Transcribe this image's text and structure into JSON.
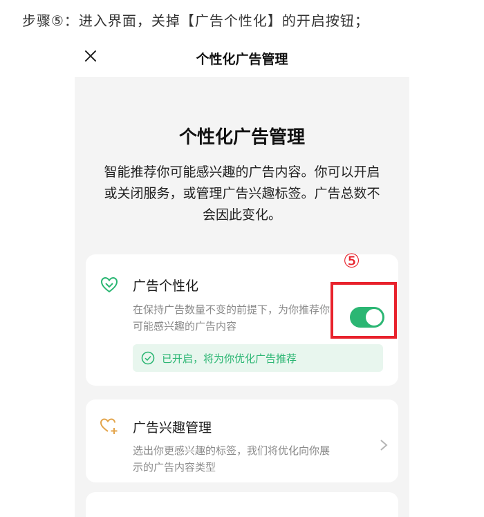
{
  "instruction": "步骤⑤：进入界面，关掉【广告个性化】的开启按钮；",
  "topbar": {
    "title": "个性化广告管理"
  },
  "main": {
    "heading": "个性化广告管理",
    "description": "智能推荐你可能感兴趣的广告内容。你可以开启或关闭服务，或管理广告兴趣标签。广告总数不会因此变化。"
  },
  "cards": {
    "personalization": {
      "title": "广告个性化",
      "description": "在保持广告数量不变的前提下，为你推荐你可能感兴趣的广告内容",
      "toggle_on": true,
      "status": "已开启，将为你优化广告推荐"
    },
    "interests": {
      "title": "广告兴趣管理",
      "description": "选出你更感兴趣的标签，我们将优化向你展示的广告内容类型"
    }
  },
  "annotation": {
    "step_marker": "⑤"
  },
  "colors": {
    "accent_green": "#2bb673",
    "interest_orange": "#e3a44a",
    "annotation_red": "#e8222c"
  },
  "icons": {
    "close": "close-icon",
    "personalization": "heart-plus-icon",
    "interests": "heart-plus-icon",
    "status": "check-circle-icon",
    "chevron": "chevron-right-icon"
  }
}
